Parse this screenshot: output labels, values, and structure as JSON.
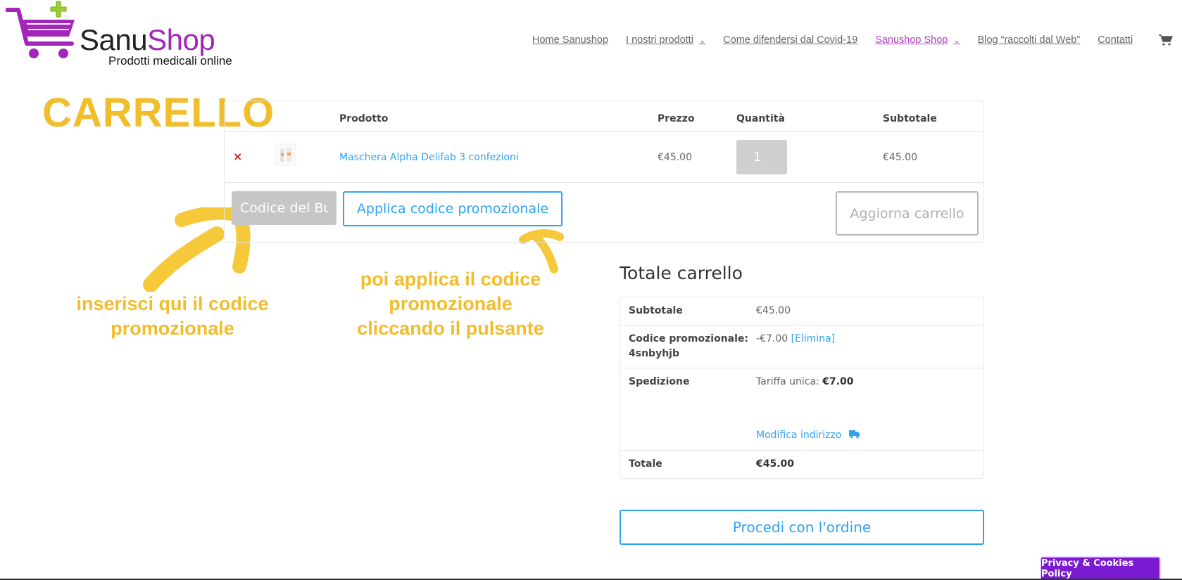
{
  "logo": {
    "brand_part1": "Sanu",
    "brand_part2": "Shop",
    "tagline": "Prodotti medicali online"
  },
  "nav": {
    "items": [
      {
        "label": "Home Sanushop"
      },
      {
        "label": "I nostri prodotti"
      },
      {
        "label": "Come difendersi dal Covid-19"
      },
      {
        "label": "Sanushop Shop"
      },
      {
        "label": "Blog “raccolti dal Web”"
      },
      {
        "label": "Contatti"
      }
    ]
  },
  "annotations": {
    "title": "CARRELLO",
    "left_line1": "inserisci qui il codice",
    "left_line2": "promozionale",
    "right_line1": "poi applica il codice",
    "right_line2": "promozionale",
    "right_line3": "cliccando il pulsante"
  },
  "cart": {
    "headers": {
      "product": "Prodotto",
      "price": "Prezzo",
      "quantity": "Quantità",
      "subtotal": "Subtotale"
    },
    "remove_symbol": "×",
    "item": {
      "name": "Maschera Alpha Delifab 3 confezioni",
      "price": "€45.00",
      "quantity": "1",
      "subtotal": "€45.00"
    },
    "coupon_value": "Codice del Bu",
    "apply_coupon_label": "Applica codice promozionale",
    "update_cart_label": "Aggiorna carrello"
  },
  "totals": {
    "title": "Totale carrello",
    "subtotal_label": "Subtotale",
    "subtotal_value": "€45.00",
    "coupon_label": "Codice promozionale:",
    "coupon_code": "4snbyhjb",
    "coupon_discount": "-€7.00",
    "coupon_remove": "[Elimina]",
    "shipping_label": "Spedizione",
    "shipping_rate_label": "Tariffa unica:",
    "shipping_rate_value": "€7.00",
    "change_address": "Modifica indirizzo",
    "total_label": "Totale",
    "total_value": "€45.00"
  },
  "checkout_label": "Procedi con l'ordine",
  "privacy_label": "Privacy & Cookies Policy",
  "colors": {
    "accent": "#2ea3f2",
    "brand_purple": "#a325b9",
    "annotation": "#f1bd2a",
    "remove": "#e01a1a",
    "privacy_bg": "#7a1bd1"
  },
  "icons": [
    "cart-logo-icon",
    "chevron-down-icon",
    "cart-icon",
    "remove-icon",
    "truck-icon",
    "arrow-annotation-icon"
  ]
}
